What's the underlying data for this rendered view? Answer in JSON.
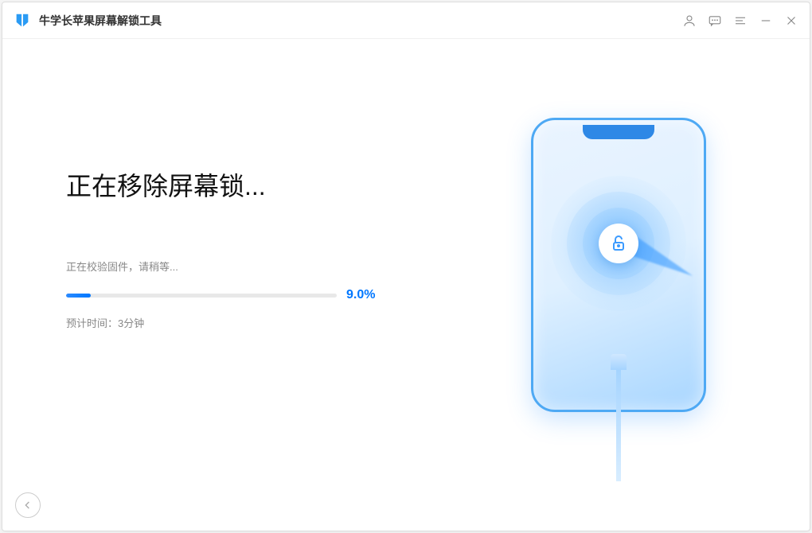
{
  "app": {
    "title": "牛学长苹果屏幕解锁工具"
  },
  "main": {
    "heading": "正在移除屏幕锁...",
    "status": "正在校验固件，请稍等...",
    "progress": {
      "percent_label": "9.0%",
      "percent_value": 9.0,
      "bar_width": "9%"
    },
    "estimate": "预计时间：3分钟"
  },
  "icons": {
    "logo": "logo-shield",
    "user": "user-icon",
    "feedback": "chat-icon",
    "menu": "menu-icon",
    "minimize": "minimize-icon",
    "close": "close-icon",
    "back": "back-arrow-icon",
    "lock": "unlock-icon"
  },
  "colors": {
    "primary": "#0077ff",
    "progress_bg": "#e8e8e8"
  }
}
